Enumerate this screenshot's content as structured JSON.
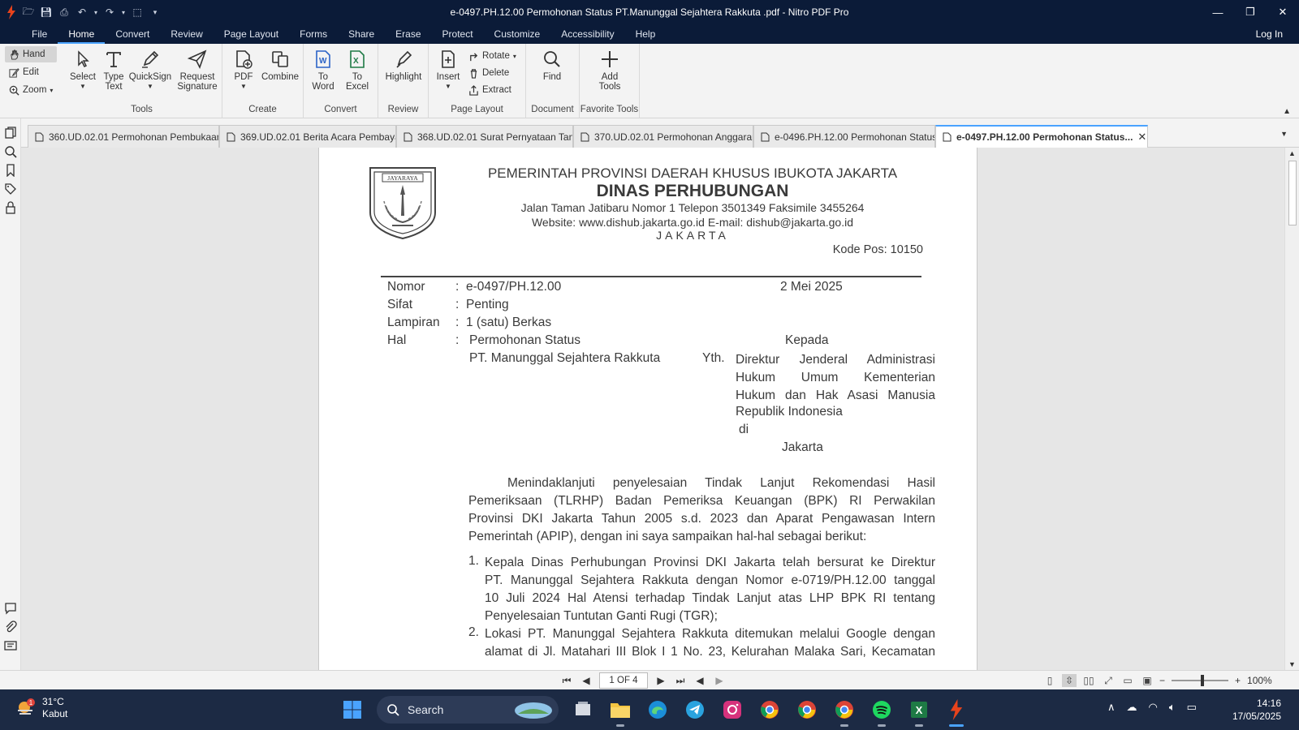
{
  "window": {
    "title": "e-0497.PH.12.00 Permohonan Status PT.Manunggal Sejahtera Rakkuta .pdf - Nitro PDF Pro"
  },
  "menu": {
    "tabs": [
      "File",
      "Home",
      "Convert",
      "Review",
      "Page Layout",
      "Forms",
      "Share",
      "Erase",
      "Protect",
      "Customize",
      "Accessibility",
      "Help"
    ],
    "active": "Home",
    "login": "Log In"
  },
  "ribbon": {
    "modes": [
      "Hand",
      "Edit",
      "Zoom"
    ],
    "tools": {
      "label": "Tools",
      "select": "Select",
      "type_text": [
        "Type",
        "Text"
      ],
      "quicksign": "QuickSign",
      "request_signature": [
        "Request",
        "Signature"
      ]
    },
    "create": {
      "label": "Create",
      "pdf": "PDF",
      "combine": "Combine"
    },
    "convert": {
      "label": "Convert",
      "to_word": [
        "To",
        "Word"
      ],
      "to_excel": [
        "To",
        "Excel"
      ]
    },
    "review": {
      "label": "Review",
      "highlight": "Highlight"
    },
    "page_layout": {
      "label": "Page Layout",
      "insert": "Insert",
      "rotate": "Rotate",
      "delete": "Delete",
      "extract": "Extract"
    },
    "document": {
      "label": "Document",
      "find": "Find"
    },
    "favorite": {
      "label": "Favorite Tools",
      "add_tools": [
        "Add",
        "Tools"
      ]
    }
  },
  "doc_tabs": [
    "360.UD.02.01 Permohonan Pembukaan...",
    "369.UD.02.01 Berita Acara Pembaya...",
    "368.UD.02.01 Surat Pernyataan Tan...",
    "370.UD.02.01 Permohonan Anggaran",
    "e-0496.PH.12.00 Permohonan Status...",
    "e-0497.PH.12.00 Permohonan Status..."
  ],
  "active_doc_tab": 5,
  "letter": {
    "crest_text": "JAYARAYA",
    "header1": "PEMERINTAH PROVINSI DAERAH KHUSUS IBUKOTA JAKARTA",
    "header2": "DINAS PERHUBUNGAN",
    "header3": "Jalan Taman Jatibaru Nomor 1 Telepon 3501349  Faksimile 3455264",
    "header4": "Website: www.dishub.jakarta.go.id   E-mail: dishub@jakarta.go.id",
    "header5": "JAKARTA",
    "kode_pos": "Kode Pos: 10150",
    "nomor_label": "Nomor",
    "nomor_value": "e-0497/PH.12.00",
    "date": "2 Mei 2025",
    "sifat_label": "Sifat",
    "sifat_value": "Penting",
    "lampiran_label": "Lampiran",
    "lampiran_value": "1 (satu) Berkas",
    "hal_label": "Hal",
    "hal_value1": "Permohonan Status",
    "hal_value2": "PT. Manunggal Sejahtera Rakkuta",
    "colon": ":",
    "kepada": "Kepada",
    "yth": "Yth.",
    "recipient": [
      "Direktur    Jenderal    Administrasi",
      "Hukum    Umum    Kementerian",
      "Hukum dan Hak Asasi Manusia",
      "Republik Indonesia"
    ],
    "di": "di",
    "city": "Jakarta",
    "para1": [
      "Menindaklanjuti penyelesaian Tindak Lanjut Rekomendasi Hasil",
      "Pemeriksaan (TLRHP) Badan Pemeriksa Keuangan (BPK) RI Perwakilan",
      "Provinsi DKI Jakarta Tahun 2005 s.d. 2023 dan Aparat Pengawasan Intern",
      "Pemerintah (APIP), dengan ini saya sampaikan hal-hal sebagai berikut:"
    ],
    "item1_num": "1.",
    "item1": [
      "Kepala Dinas Perhubungan Provinsi DKI Jakarta telah bersurat ke Direktur",
      "PT. Manunggal Sejahtera Rakkuta dengan Nomor e-0719/PH.12.00 tanggal",
      "10 Juli 2024 Hal Atensi terhadap Tindak Lanjut atas LHP BPK RI tentang",
      "Penyelesaian Tuntutan Ganti Rugi (TGR);"
    ],
    "item2_num": "2.",
    "item2": [
      "Lokasi PT. Manunggal Sejahtera Rakkuta ditemukan melalui Google dengan",
      "alamat di Jl. Matahari III Blok I 1 No. 23, Kelurahan Malaka Sari, Kecamatan"
    ]
  },
  "status": {
    "page_indicator": "1 OF 4",
    "zoom": "100%"
  },
  "taskbar": {
    "temp": "31°C",
    "weather": "Kabut",
    "weather_badge": "1",
    "search": "Search",
    "time": "14:16",
    "date": "17/05/2025"
  },
  "colors": {
    "titlebar": "#0b1b38",
    "accent": "#4aa3ff",
    "word": "#2b63c7",
    "excel": "#1e7a45",
    "nitro": "#e8431c"
  }
}
